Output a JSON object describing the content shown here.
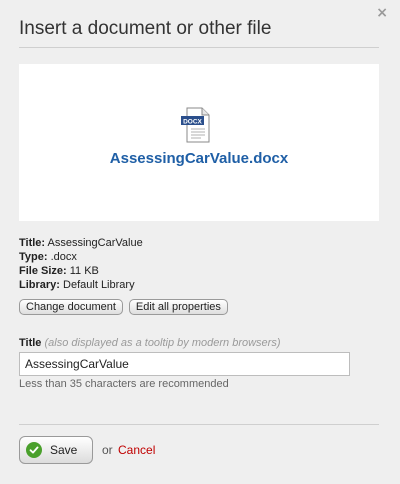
{
  "dialog": {
    "title": "Insert a document or other file",
    "close_glyph": "×"
  },
  "preview": {
    "icon_badge": "DOCX",
    "file_name": "AssessingCarValue.docx"
  },
  "meta": {
    "title_label": "Title:",
    "title_value": "AssessingCarValue",
    "type_label": "Type:",
    "type_value": ".docx",
    "size_label": "File Size:",
    "size_value": "11 KB",
    "library_label": "Library:",
    "library_value": "Default Library"
  },
  "actions": {
    "change_document": "Change document",
    "edit_properties": "Edit all properties"
  },
  "title_field": {
    "label": "Title",
    "label_note": "(also displayed as a tooltip by modern browsers)",
    "value": "AssessingCarValue",
    "hint": "Less than 35 characters are recommended"
  },
  "footer": {
    "save_label": "Save",
    "or_text": "or",
    "cancel_label": "Cancel"
  },
  "colors": {
    "file_name": "#1f5fa6",
    "cancel": "#c00000",
    "save_check": "#4aa02c",
    "docx_badge": "#2b4f8c"
  }
}
